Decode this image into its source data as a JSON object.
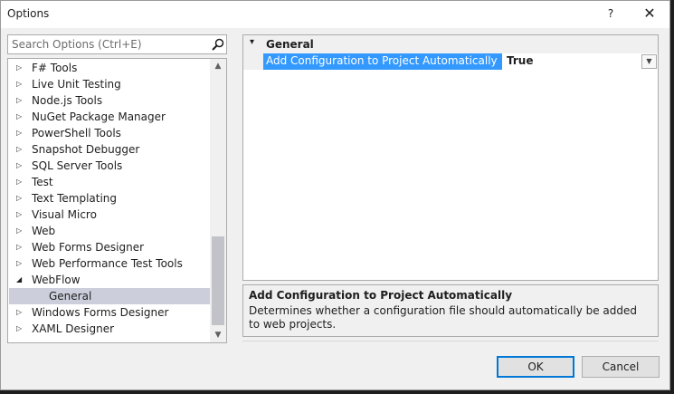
{
  "window": {
    "title": "Options",
    "help_glyph": "?",
    "close_glyph": "✕"
  },
  "search": {
    "placeholder": "Search Options (Ctrl+E)",
    "value": ""
  },
  "tree": {
    "items": [
      {
        "label": "F# Tools",
        "expanded": false
      },
      {
        "label": "Live Unit Testing",
        "expanded": false
      },
      {
        "label": "Node.js Tools",
        "expanded": false
      },
      {
        "label": "NuGet Package Manager",
        "expanded": false
      },
      {
        "label": "PowerShell Tools",
        "expanded": false
      },
      {
        "label": "Snapshot Debugger",
        "expanded": false
      },
      {
        "label": "SQL Server Tools",
        "expanded": false
      },
      {
        "label": "Test",
        "expanded": false
      },
      {
        "label": "Text Templating",
        "expanded": false
      },
      {
        "label": "Visual Micro",
        "expanded": false
      },
      {
        "label": "Web",
        "expanded": false
      },
      {
        "label": "Web Forms Designer",
        "expanded": false
      },
      {
        "label": "Web Performance Test Tools",
        "expanded": false
      },
      {
        "label": "WebFlow",
        "expanded": true
      },
      {
        "label": "General",
        "child": true,
        "selected": true
      },
      {
        "label": "Windows Forms Designer",
        "expanded": false
      },
      {
        "label": "XAML Designer",
        "expanded": false
      }
    ]
  },
  "property_grid": {
    "category": "General",
    "property_name": "Add Configuration to Project Automatically",
    "property_value": "True"
  },
  "description": {
    "title": "Add Configuration to Project Automatically",
    "text": "Determines whether a configuration file should automatically be added to web projects."
  },
  "buttons": {
    "ok": "OK",
    "cancel": "Cancel"
  },
  "colors": {
    "selection_blue": "#3399ff",
    "tree_selected": "#cccedb",
    "ok_border": "#0078d7"
  }
}
